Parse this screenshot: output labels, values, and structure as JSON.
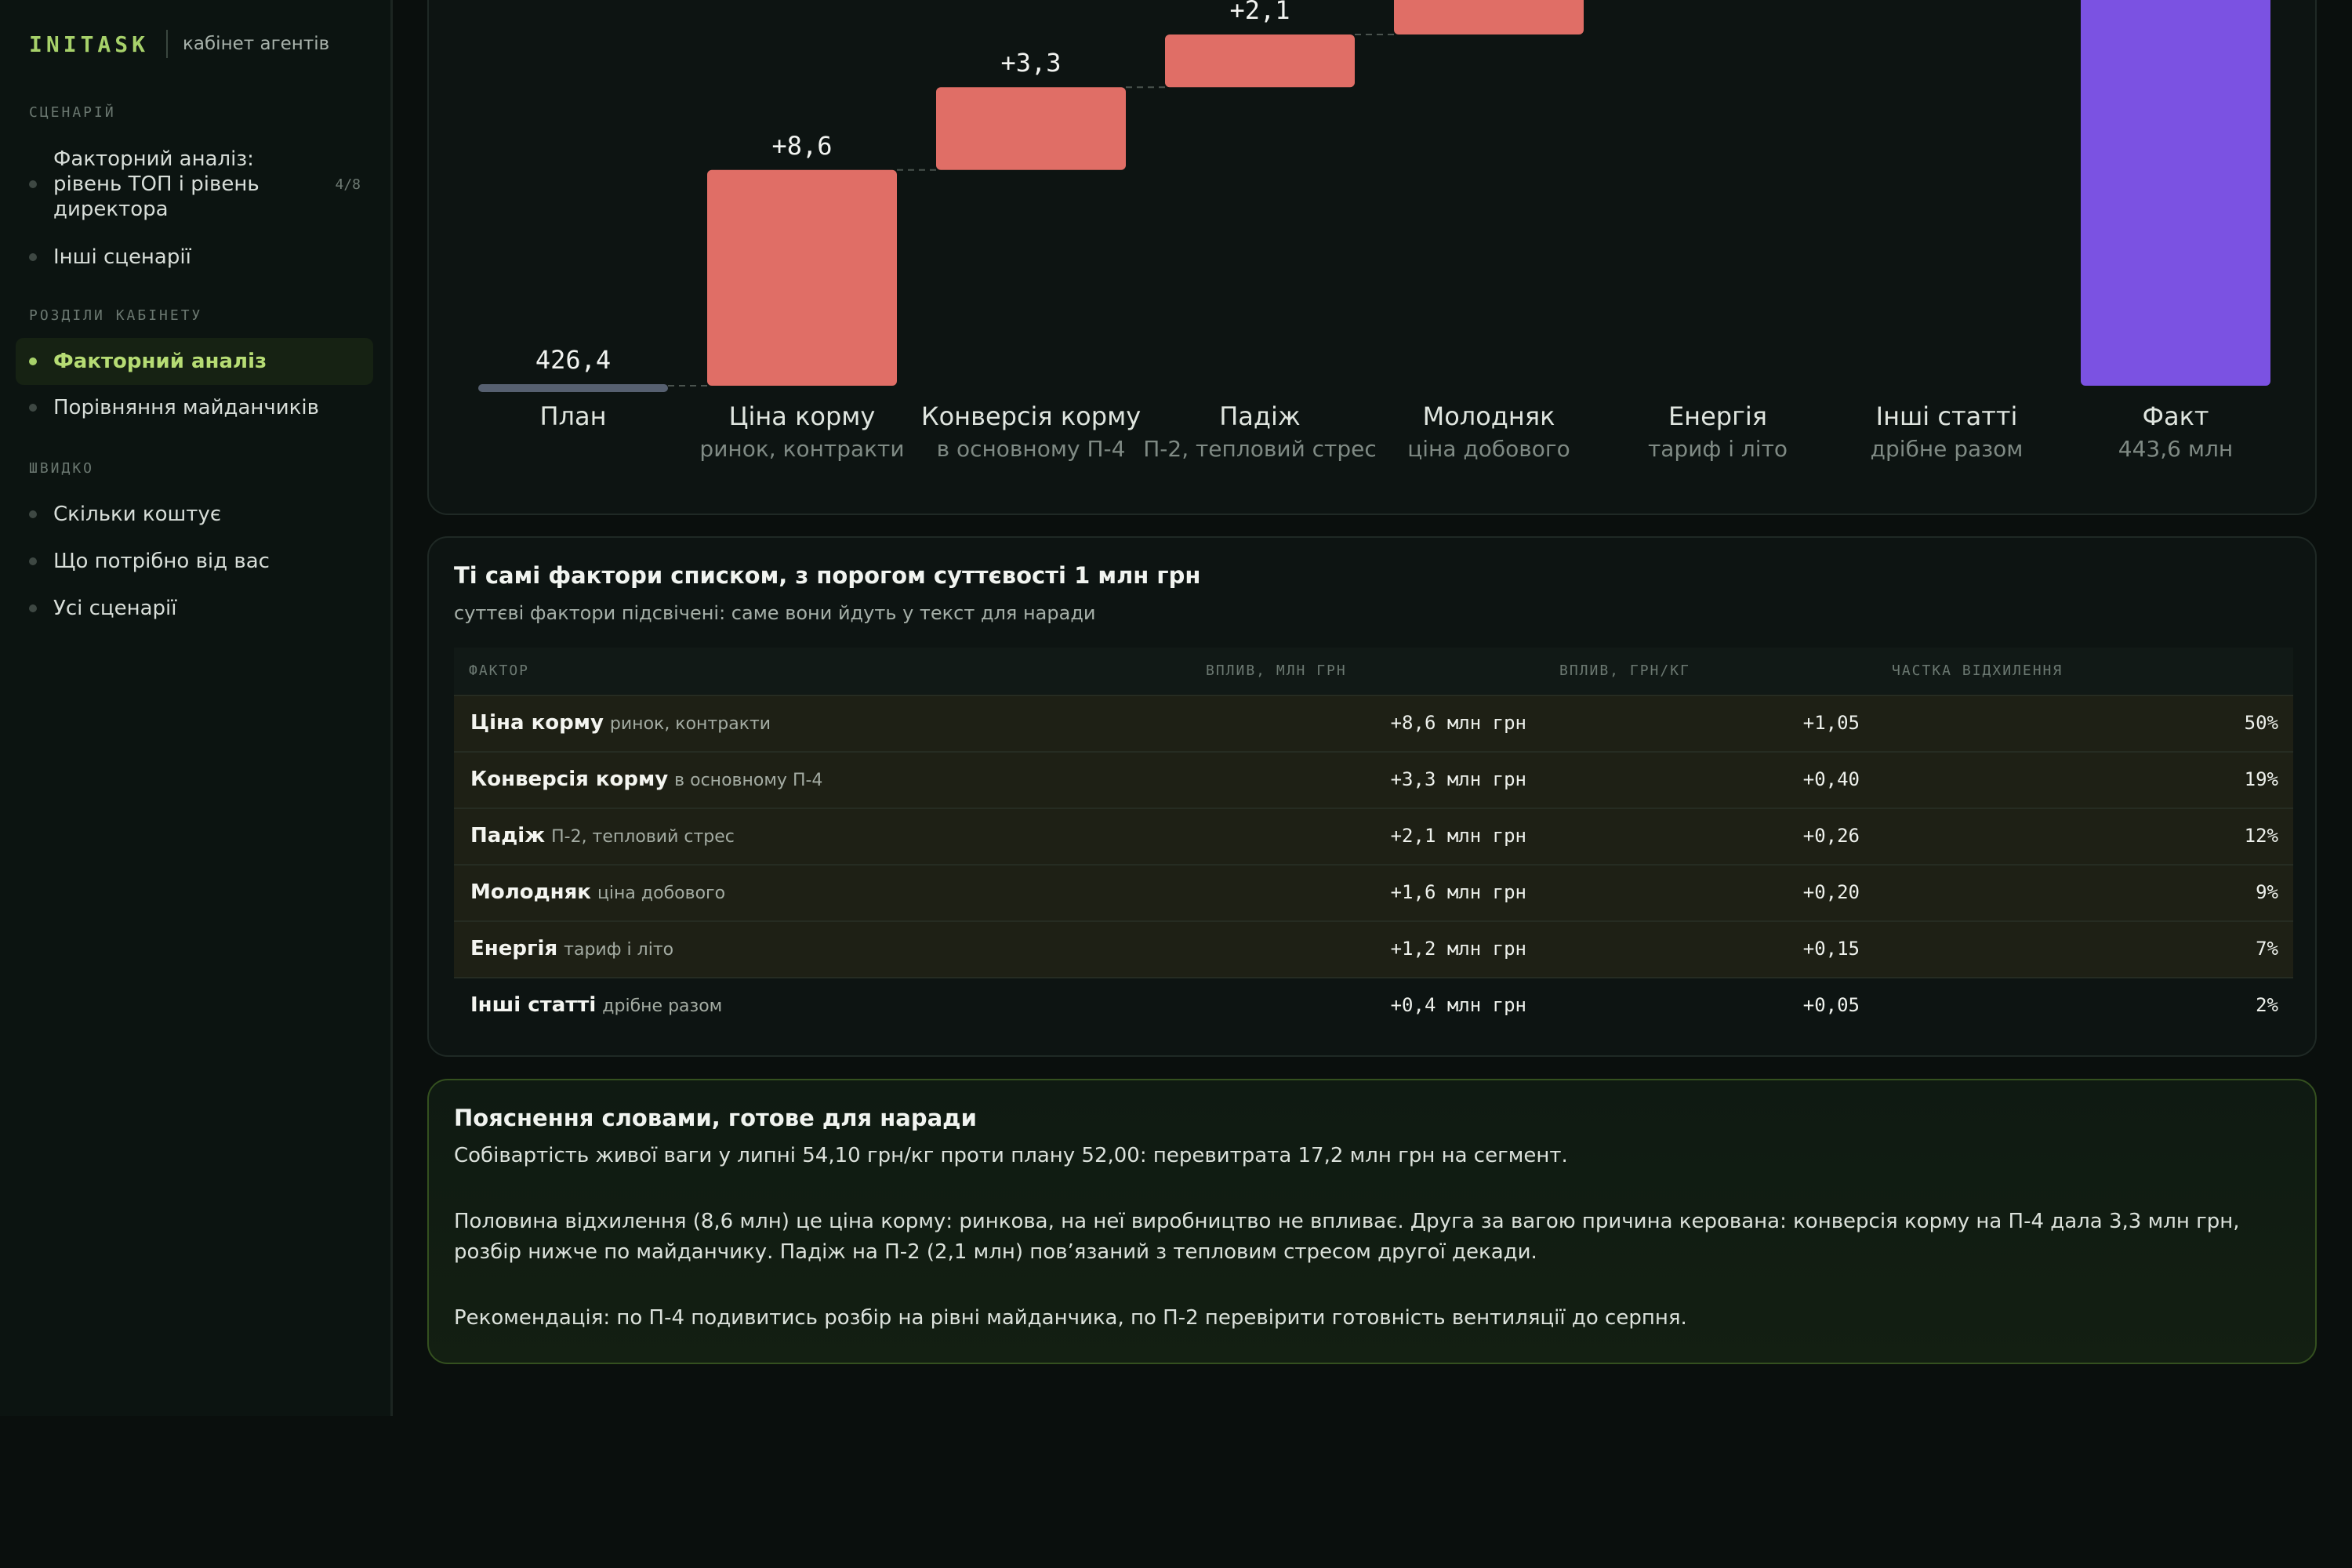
{
  "sidebar": {
    "brand": "INITASK",
    "brand_sub": "кабінет агентів",
    "scenarios_label": "СЦЕНАРІЙ",
    "scenarios": [
      {
        "label": "Факторний аналіз: рівень ТОП і рівень директора",
        "badge": "4/8"
      },
      {
        "label": "Інші сценарії"
      }
    ],
    "sections_label": "РОЗДІЛИ КАБІНЕТУ",
    "sections": [
      {
        "label": "Факторний аналіз",
        "active": true
      },
      {
        "label": "Порівняння майданчиків"
      }
    ],
    "quick_label": "ШВИДКО",
    "quick": [
      {
        "label": "Скільки коштує"
      },
      {
        "label": "Що потрібно від вас"
      },
      {
        "label": "Усі сценарії"
      }
    ]
  },
  "chart_data": {
    "type": "waterfall",
    "colors": {
      "base": "#566070",
      "increase": "#e06e66",
      "total": "#7b52e2"
    },
    "categories": [
      {
        "label": "План",
        "sub": "",
        "value": 426.4,
        "kind": "base",
        "value_label": "426,4"
      },
      {
        "label": "Ціна корму",
        "sub": "ринок, контракти",
        "value": 8.6,
        "kind": "delta",
        "value_label": "+8,6"
      },
      {
        "label": "Конверсія корму",
        "sub": "в основному П-4",
        "value": 3.3,
        "kind": "delta",
        "value_label": "+3,3"
      },
      {
        "label": "Падіж",
        "sub": "П-2, тепловий стрес",
        "value": 2.1,
        "kind": "delta",
        "value_label": "+2,1"
      },
      {
        "label": "Молодняк",
        "sub": "ціна добового",
        "value": 1.6,
        "kind": "delta",
        "value_label": ""
      },
      {
        "label": "Енергія",
        "sub": "тариф і літо",
        "value": 1.2,
        "kind": "delta",
        "value_label": ""
      },
      {
        "label": "Інші статті",
        "sub": "дрібне разом",
        "value": 0.4,
        "kind": "delta",
        "value_label": ""
      },
      {
        "label": "Факт",
        "sub": "443,6 млн",
        "value": 443.6,
        "kind": "total",
        "value_label": ""
      }
    ]
  },
  "table": {
    "title": "Ті самі фактори списком, з порогом суттєвості 1 млн грн",
    "subtitle": "суттєві фактори підсвічені: саме вони йдуть у текст для наради",
    "headers": [
      "ФАКТОР",
      "ВПЛИВ, МЛН ГРН",
      "ВПЛИВ, ГРН/КГ",
      "ЧАСТКА ВІДХИЛЕННЯ"
    ],
    "rows": [
      {
        "name": "Ціна корму",
        "note": "ринок, контракти",
        "impact": "+8,6 млн грн",
        "per_kg": "+1,05",
        "share": "50%",
        "significant": true
      },
      {
        "name": "Конверсія корму",
        "note": "в основному П-4",
        "impact": "+3,3 млн грн",
        "per_kg": "+0,40",
        "share": "19%",
        "significant": true
      },
      {
        "name": "Падіж",
        "note": "П-2, тепловий стрес",
        "impact": "+2,1 млн грн",
        "per_kg": "+0,26",
        "share": "12%",
        "significant": true
      },
      {
        "name": "Молодняк",
        "note": "ціна добового",
        "impact": "+1,6 млн грн",
        "per_kg": "+0,20",
        "share": "9%",
        "significant": true
      },
      {
        "name": "Енергія",
        "note": "тариф і літо",
        "impact": "+1,2 млн грн",
        "per_kg": "+0,15",
        "share": "7%",
        "significant": true
      },
      {
        "name": "Інші статті",
        "note": "дрібне разом",
        "impact": "+0,4 млн грн",
        "per_kg": "+0,05",
        "share": "2%",
        "significant": false
      }
    ]
  },
  "explanation": {
    "title": "Пояснення словами, готове для наради",
    "p1": "Собівартість живої ваги у липні 54,10 грн/кг проти плану 52,00: перевитрата 17,2 млн грн на сегмент.",
    "p2": "Половина відхилення (8,6 млн) це ціна корму: ринкова, на неї виробництво не впливає. Друга за вагою причина керована: конверсія корму на П-4 дала 3,3 млн грн, розбір нижче по майданчику. Падіж на П-2 (2,1 млн) пов’язаний з тепловим стресом другої декади.",
    "p3": "Рекомендація: по П-4 подивитись розбір на рівні майданчика, по П-2 перевірити готовність вентиляції до серпня."
  }
}
